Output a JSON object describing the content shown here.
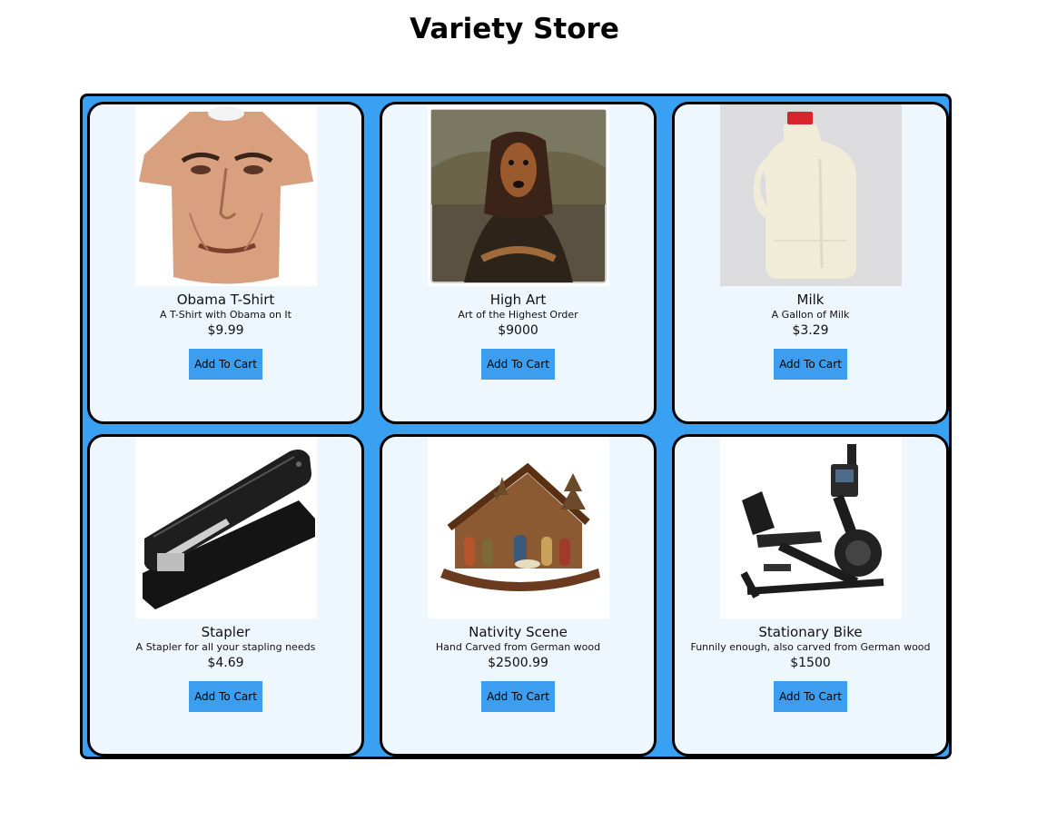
{
  "page": {
    "title": "Variety Store"
  },
  "products": [
    {
      "name": "Obama T-Shirt",
      "description": "A T-Shirt with Obama on It",
      "price": "$9.99",
      "button_label": "Add To Cart",
      "image_icon": "tshirt-image"
    },
    {
      "name": "High Art",
      "description": "Art of the Highest Order",
      "price": "$9000",
      "button_label": "Add To Cart",
      "image_icon": "painting-image"
    },
    {
      "name": "Milk",
      "description": "A Gallon of Milk",
      "price": "$3.29",
      "button_label": "Add To Cart",
      "image_icon": "milk-jug-image"
    },
    {
      "name": "Stapler",
      "description": "A Stapler for all your stapling needs",
      "price": "$4.69",
      "button_label": "Add To Cart",
      "image_icon": "stapler-image"
    },
    {
      "name": "Nativity Scene",
      "description": "Hand Carved from German wood",
      "price": "$2500.99",
      "button_label": "Add To Cart",
      "image_icon": "nativity-scene-image"
    },
    {
      "name": "Stationary Bike",
      "description": "Funnily enough, also carved from German wood",
      "price": "$1500",
      "button_label": "Add To Cart",
      "image_icon": "exercise-bike-image"
    }
  ],
  "colors": {
    "grid_background": "#3aa0f2",
    "card_background": "#eef7fe",
    "button": "#3d9ef0"
  }
}
